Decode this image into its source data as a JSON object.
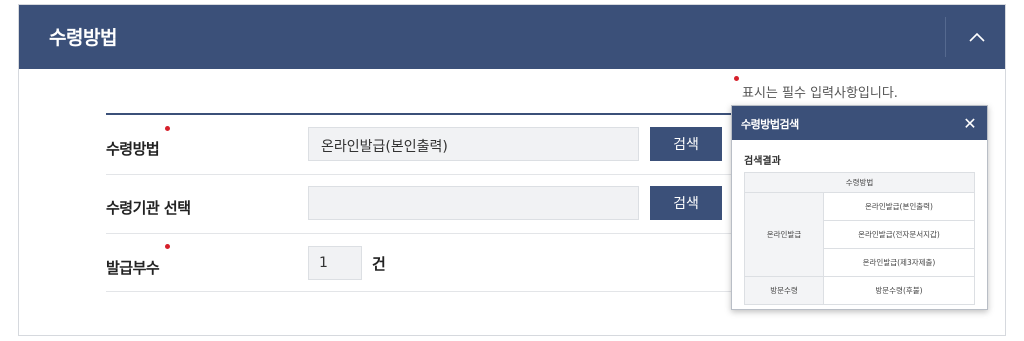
{
  "panel": {
    "title": "수령방법",
    "collapse_icon": "chevron-up-icon"
  },
  "required_note": "표시는 필수 입력사항입니다.",
  "form": {
    "receipt_method": {
      "label": "수령방법",
      "value": "온라인발급(본인출력)",
      "button": "검색"
    },
    "institution": {
      "label": "수령기관 선택",
      "value": "",
      "button": "검색"
    },
    "copies": {
      "label": "발급부수",
      "value": "1",
      "unit": "건"
    }
  },
  "popup": {
    "title": "수령방법검색",
    "close_icon": "close-icon",
    "close_label": "✕",
    "subtitle": "검색결과",
    "table_header": "수령방법",
    "groups": [
      {
        "name": "온라인발급",
        "items": [
          "온라인발급(본인출력)",
          "온라인발급(전자문서지갑)",
          "온라인발급(제3자제출)"
        ]
      },
      {
        "name": "방문수령",
        "items": [
          "방문수령(후불)"
        ]
      }
    ]
  },
  "colors": {
    "header": "#3b5079",
    "required": "#d6202b"
  }
}
